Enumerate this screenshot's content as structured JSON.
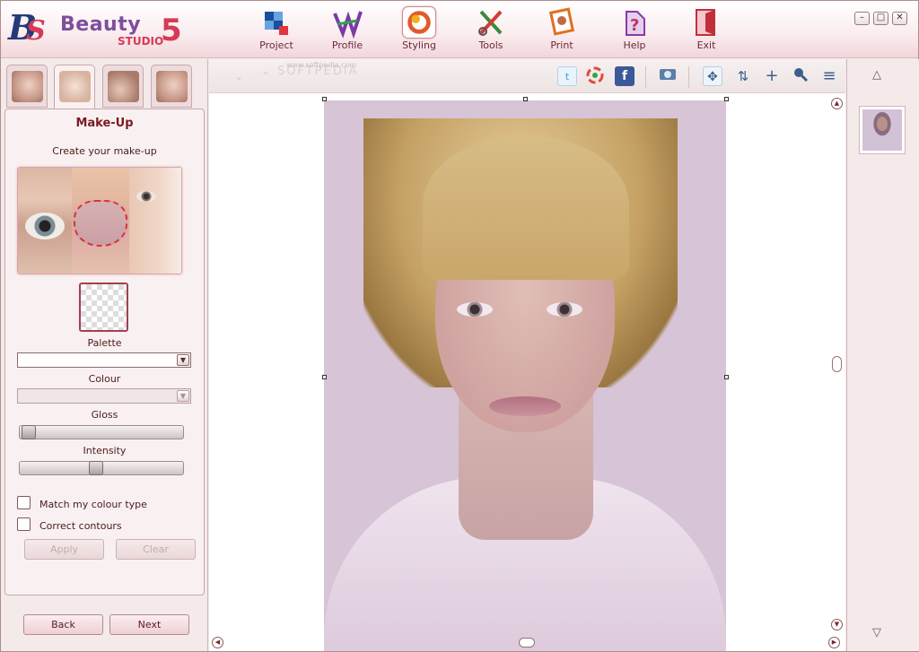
{
  "app": {
    "logo_text": "Beauty",
    "logo_sub": "STUDIO",
    "logo_version": "5"
  },
  "toolbar": {
    "items": [
      {
        "label": "Project",
        "icon": "project-icon"
      },
      {
        "label": "Profile",
        "icon": "profile-icon"
      },
      {
        "label": "Styling",
        "icon": "styling-icon",
        "active": true
      },
      {
        "label": "Tools",
        "icon": "tools-icon"
      },
      {
        "label": "Print",
        "icon": "print-icon"
      },
      {
        "label": "Help",
        "icon": "help-icon"
      },
      {
        "label": "Exit",
        "icon": "exit-icon"
      }
    ],
    "window_controls": {
      "minimize": "–",
      "maximize": "□",
      "close": "✕"
    }
  },
  "left_panel": {
    "tabs": [
      "hair-tab",
      "makeup-tab",
      "accessories-tab",
      "face-tab"
    ],
    "title": "Make-Up",
    "subtitle": "Create your make-up",
    "palette_label": "Palette",
    "palette_value": "",
    "colour_label": "Colour",
    "colour_value": "",
    "gloss_label": "Gloss",
    "gloss_value": 0.0,
    "intensity_label": "Intensity",
    "intensity_value": 0.45,
    "match_colour_label": "Match my colour type",
    "match_colour_checked": false,
    "correct_contours_label": "Correct contours",
    "correct_contours_checked": false,
    "apply_label": "Apply",
    "clear_label": "Clear",
    "back_label": "Back",
    "next_label": "Next"
  },
  "canvas_toolbar": {
    "icons": [
      "twitter-icon",
      "picasa-icon",
      "facebook-icon",
      "camera-icon",
      "move-icon",
      "rotate-icon",
      "crosshair-icon",
      "zoom-icon",
      "menu-icon"
    ],
    "watermark": "SOFTPEDIA",
    "watermark_url": "www.softpedia.com"
  },
  "colors": {
    "accent": "#d63a56",
    "title_red": "#7a1a22",
    "header_bg": "#fbeef0"
  }
}
